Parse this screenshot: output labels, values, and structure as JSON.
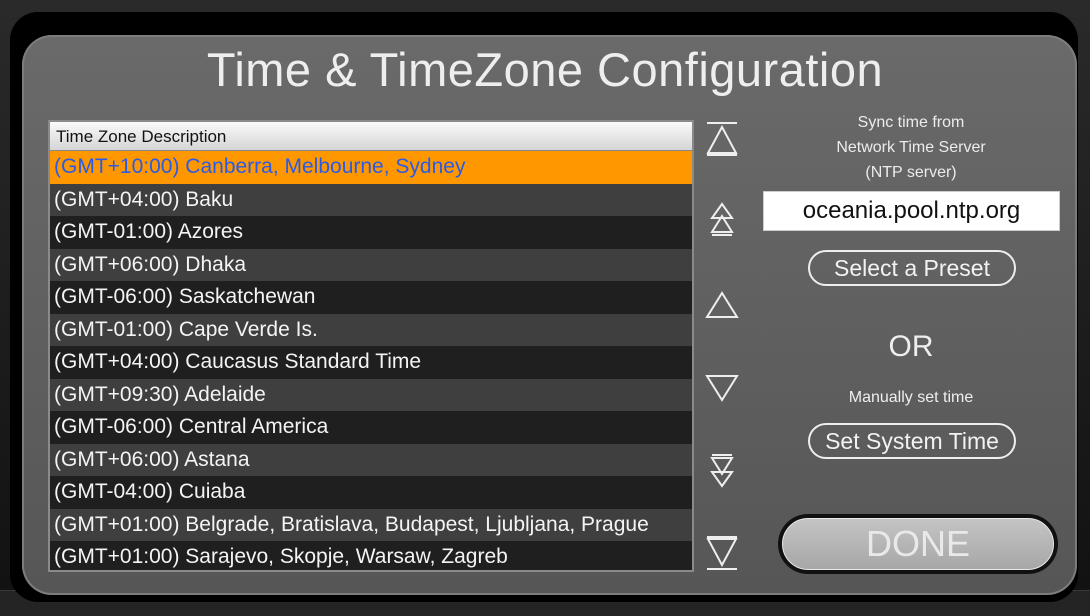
{
  "dialog": {
    "title": "Time & TimeZone Configuration"
  },
  "timezone_list": {
    "header": "Time Zone Description",
    "selected_index": 0,
    "rows": [
      "(GMT+10:00) Canberra, Melbourne, Sydney",
      "(GMT+04:00) Baku",
      "(GMT-01:00) Azores",
      "(GMT+06:00) Dhaka",
      "(GMT-06:00) Saskatchewan",
      "(GMT-01:00) Cape Verde Is.",
      "(GMT+04:00) Caucasus Standard Time",
      "(GMT+09:30) Adelaide",
      "(GMT-06:00) Central America",
      "(GMT+06:00) Astana",
      "(GMT-04:00) Cuiaba",
      "(GMT+01:00) Belgrade, Bratislava, Budapest, Ljubljana, Prague",
      "(GMT+01:00) Sarajevo, Skopje, Warsaw, Zagreb"
    ]
  },
  "scroll_controls": {
    "icons": [
      "scroll-top-icon",
      "page-up-icon",
      "scroll-up-icon",
      "scroll-down-icon",
      "page-down-icon",
      "scroll-bottom-icon"
    ]
  },
  "ntp": {
    "sync_line1": "Sync time from",
    "sync_line2": "Network Time Server",
    "sync_line3": "(NTP server)",
    "server_value": "oceania.pool.ntp.org",
    "preset_label": "Select a Preset"
  },
  "manual": {
    "or_label": "OR",
    "manual_label": "Manually set time",
    "set_time_label": "Set System Time"
  },
  "done_label": "DONE",
  "colors": {
    "selection": "#ff9800",
    "selection_text": "#2a5ae8",
    "panel": "#5e5e5e"
  }
}
